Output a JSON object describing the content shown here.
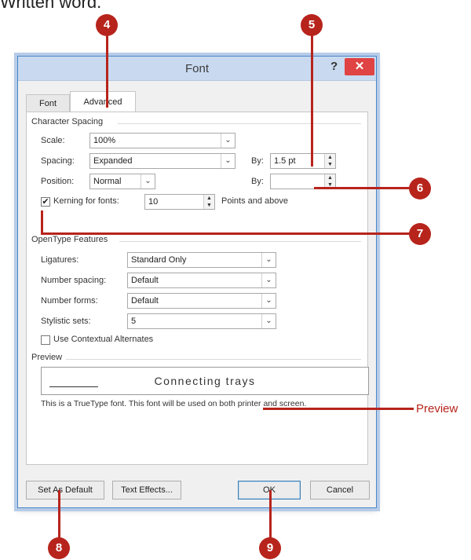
{
  "page": {
    "top_text": "Written word."
  },
  "dialog": {
    "title": "Font",
    "help_label": "?",
    "close_label": "✕",
    "tabs": [
      {
        "label": "Font",
        "active": false
      },
      {
        "label": "Advanced",
        "active": true
      }
    ],
    "character_spacing": {
      "group_label": "Character Spacing",
      "scale_label": "Scale:",
      "scale_value": "100%",
      "spacing_label": "Spacing:",
      "spacing_value": "Expanded",
      "spacing_by_label": "By:",
      "spacing_by_value": "1.5 pt",
      "position_label": "Position:",
      "position_value": "Normal",
      "position_by_label": "By:",
      "position_by_value": "",
      "kerning_checked": true,
      "kerning_label": "Kerning for fonts:",
      "kerning_value": "10",
      "kerning_suffix": "Points and above"
    },
    "opentype": {
      "group_label": "OpenType Features",
      "ligatures_label": "Ligatures:",
      "ligatures_value": "Standard Only",
      "number_spacing_label": "Number spacing:",
      "number_spacing_value": "Default",
      "number_forms_label": "Number forms:",
      "number_forms_value": "Default",
      "stylistic_sets_label": "Stylistic sets:",
      "stylistic_sets_value": "5",
      "contextual_checked": false,
      "contextual_label": "Use Contextual Alternates"
    },
    "preview": {
      "group_label": "Preview",
      "sample_text": "Connecting trays",
      "note": "This is a TrueType font. This font will be used on both printer and screen."
    },
    "buttons": {
      "set_default": "Set As Default",
      "text_effects": "Text Effects...",
      "ok": "OK",
      "cancel": "Cancel"
    }
  },
  "callouts": {
    "c4": "4",
    "c5": "5",
    "c6": "6",
    "c7": "7",
    "c8": "8",
    "c9": "9",
    "preview_label": "Preview"
  },
  "colors": {
    "callout": "#b7241c",
    "close_button": "#e04343",
    "titlebar": "#c9daf0"
  },
  "icons": [
    "close-icon",
    "help-icon",
    "dropdown-arrow-icon",
    "spinner-icon",
    "checkbox-check-icon"
  ]
}
